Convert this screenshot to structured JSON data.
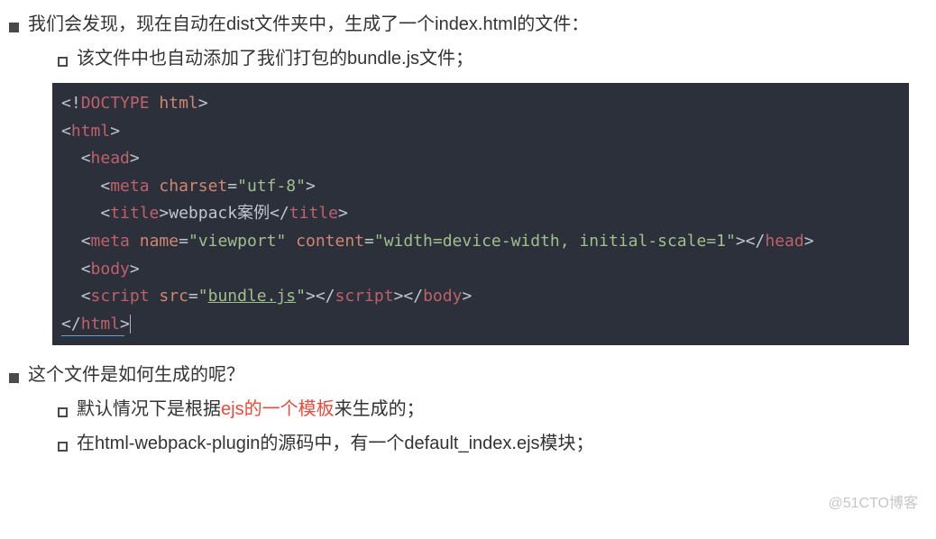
{
  "bullets": {
    "b1": "我们会发现，现在自动在dist文件夹中，生成了一个index.html的文件：",
    "b2": "这个文件是如何生成的呢？"
  },
  "subbullets": {
    "s1": "该文件中也自动添加了我们打包的bundle.js文件；",
    "s2_prefix": "默认情况下是根据",
    "s2_highlight": "ejs的一个模板",
    "s2_suffix": "来生成的；",
    "s3": "在html-webpack-plugin的源码中，有一个default_index.ejs模块；"
  },
  "code": {
    "l1": {
      "doctype_open": "<!",
      "doctype_name": "DOCTYPE",
      "space": " ",
      "doctype_attr": "html",
      "close": ">"
    },
    "l2": {
      "open": "<",
      "tag": "html",
      "close": ">"
    },
    "l3": {
      "indent": "  ",
      "open": "<",
      "tag": "head",
      "close": ">"
    },
    "l4": {
      "indent": "    ",
      "open": "<",
      "tag": "meta",
      "sp": " ",
      "attr": "charset",
      "eq": "=",
      "val": "\"utf-8\"",
      "close": ">"
    },
    "l5": {
      "indent": "    ",
      "open": "<",
      "tag": "title",
      "close1": ">",
      "text": "webpack案例",
      "open2": "</",
      "close2": ">"
    },
    "l6": {
      "indent": "  ",
      "open": "<",
      "tag": "meta",
      "sp": " ",
      "attr1": "name",
      "eq": "=",
      "val1": "\"viewport\"",
      "sp2": " ",
      "attr2": "content",
      "val2": "\"width=device-width, initial-scale=1\"",
      "close": ">",
      "open2": "</",
      "tag2": "head",
      "close2": ">"
    },
    "l7": {
      "indent": "  ",
      "open": "<",
      "tag": "body",
      "close": ">"
    },
    "l8": {
      "indent": "  ",
      "open": "<",
      "tag": "script",
      "sp": " ",
      "attr": "src",
      "eq": "=",
      "q1": "\"",
      "link": "bundle.js",
      "q2": "\"",
      "close": ">",
      "open2": "</",
      "close2": ">",
      "open3": "</",
      "tag3": "body",
      "close3": ">"
    },
    "l9": {
      "open": "</",
      "tag": "html",
      "close": ">"
    }
  },
  "watermark": "@51CTO博客"
}
